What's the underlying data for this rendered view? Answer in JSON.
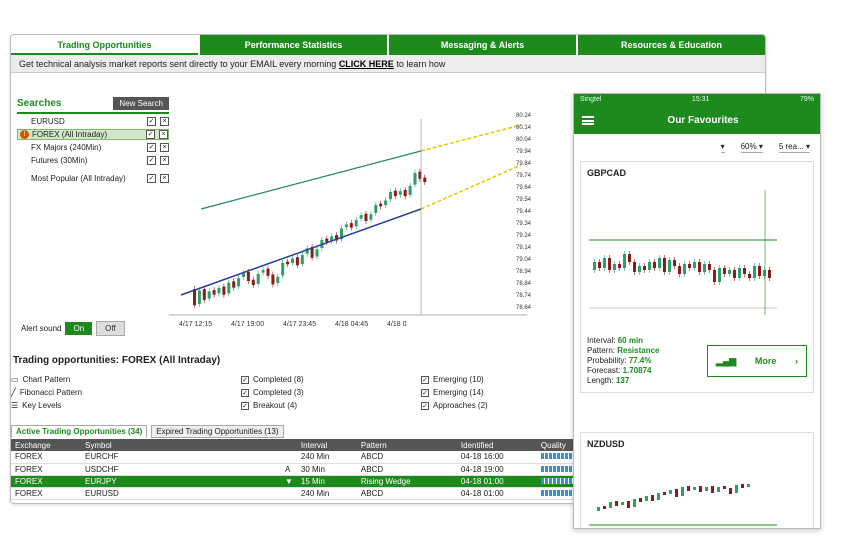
{
  "tabs": [
    "Trading Opportunities",
    "Performance Statistics",
    "Messaging & Alerts",
    "Resources & Education"
  ],
  "notice": {
    "text": "Get technical analysis market reports sent directly to your EMAIL every morning",
    "link": "CLICK HERE",
    "suffix": "to learn how"
  },
  "searches": {
    "title": "Searches",
    "new_button": "New Search",
    "items": [
      "EURUSD",
      "FOREX (All Intraday)",
      "FX Majors (240Min)",
      "Futures (30Min)",
      "Most Popular (All Intraday)"
    ]
  },
  "alert": {
    "label": "Alert sound",
    "on": "On",
    "off": "Off"
  },
  "main_chart": {
    "yticks": [
      "80.24",
      "80.14",
      "80.04",
      "79.94",
      "79.84",
      "79.74",
      "79.64",
      "79.54",
      "79.44",
      "79.34",
      "79.24",
      "79.14",
      "79.04",
      "78.94",
      "78.84",
      "78.74",
      "78.64"
    ],
    "xticks": [
      "4/17 12:15",
      "4/17 19:00",
      "4/17 23:45",
      "4/18 04:45",
      "4/18 0"
    ],
    "candles": [
      [
        1,
        -1.8
      ],
      [
        0,
        1.5
      ],
      [
        1,
        -1.2
      ],
      [
        0,
        0.8
      ],
      [
        1,
        -0.5
      ],
      [
        0,
        0.6
      ],
      [
        1,
        -0.9
      ],
      [
        0,
        1.2
      ],
      [
        1,
        -0.7
      ],
      [
        0,
        0.9
      ],
      [
        0,
        0.4
      ],
      [
        1,
        -1.0
      ],
      [
        1,
        -0.6
      ],
      [
        0,
        1.1
      ],
      [
        0,
        0.3
      ],
      [
        1,
        -0.8
      ],
      [
        1,
        -1.1
      ],
      [
        0,
        0.7
      ],
      [
        0,
        1.4
      ],
      [
        1,
        -0.3
      ],
      [
        0,
        0.5
      ],
      [
        1,
        -0.9
      ],
      [
        0,
        1.0
      ],
      [
        0,
        0.6
      ],
      [
        1,
        -1.2
      ],
      [
        0,
        0.8
      ],
      [
        0,
        0.9
      ],
      [
        1,
        -0.4
      ],
      [
        0,
        0.5
      ],
      [
        1,
        -0.6
      ],
      [
        0,
        1.2
      ],
      [
        0,
        0.3
      ],
      [
        1,
        -0.5
      ],
      [
        0,
        0.7
      ],
      [
        0,
        0.4
      ],
      [
        1,
        -0.8
      ],
      [
        0,
        0.6
      ],
      [
        0,
        0.9
      ],
      [
        1,
        -0.3
      ],
      [
        0,
        0.5
      ],
      [
        0,
        0.8
      ],
      [
        1,
        -0.6
      ],
      [
        0,
        0.4
      ],
      [
        1,
        -0.7
      ],
      [
        0,
        1.0
      ],
      [
        0,
        1.3
      ],
      [
        1,
        -0.8
      ],
      [
        1,
        -0.5
      ]
    ]
  },
  "opportunities": {
    "title": "Trading opportunities: FOREX (All Intraday)",
    "types": [
      "Chart Pattern",
      "Fibonacci Pattern",
      "Key Levels"
    ],
    "completed": [
      "Completed (8)",
      "Completed (3)",
      "Breakout (4)"
    ],
    "emerging": [
      "Emerging (10)",
      "Emerging (14)",
      "Approaches (2)"
    ]
  },
  "subtabs": [
    "Active Trading Opportunities (34)",
    "Expired Trading Opportunities (13)"
  ],
  "table": {
    "headers": [
      "Exchange",
      "Symbol",
      "",
      "Interval",
      "Pattern",
      "Identified",
      "Quality"
    ],
    "rows": [
      [
        "FOREX",
        "EURCHF",
        "",
        "240 Min",
        "ABCD",
        "04-18 16:00",
        ""
      ],
      [
        "FOREX",
        "USDCHF",
        "A",
        "30 Min",
        "ABCD",
        "04-18 19:00",
        ""
      ],
      [
        "FOREX",
        "EURJPY",
        "▼",
        "15 Min",
        "Rising Wedge",
        "04-18 01:00",
        ""
      ],
      [
        "FOREX",
        "EURUSD",
        "",
        "240 Min",
        "ABCD",
        "04-18 01:00",
        ""
      ]
    ]
  },
  "phone": {
    "status_left": "Singtel ",
    "status_mid": "15:31",
    "status_right": "79%",
    "title": "Our Favourites",
    "filters": [
      "",
      "60%",
      "5 rea..."
    ],
    "card1": {
      "symbol": "GBPCAD",
      "interval_label": "Interval:",
      "interval": "60 min",
      "pattern_label": "Pattern:",
      "pattern": "Resistance",
      "prob_label": "Probability:",
      "prob": "77.4%",
      "forecast_label": "Forecast:",
      "forecast": "1.70874",
      "length_label": "Length:",
      "length": "137",
      "more": "More"
    },
    "card2": {
      "symbol": "NZDUSD"
    }
  },
  "colors": {
    "accent": "#1e8a1e"
  }
}
